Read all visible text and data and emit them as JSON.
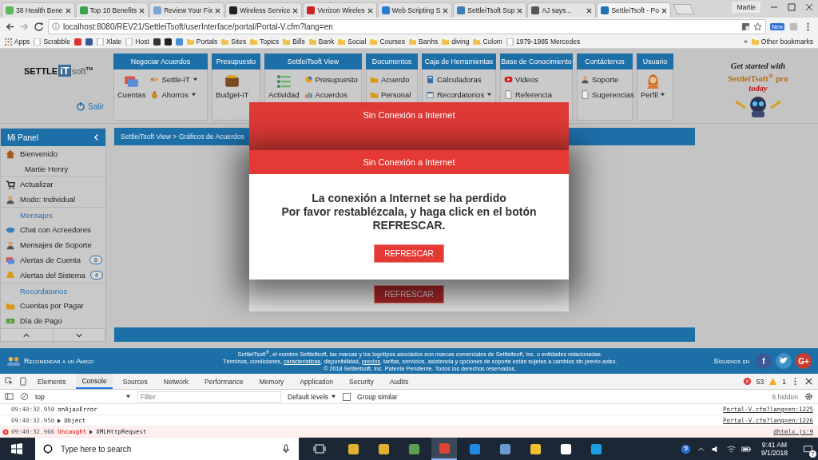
{
  "browser": {
    "tabs": [
      {
        "title": "38 Health Bene",
        "color": "#5cb85c",
        "selected": false
      },
      {
        "title": "Top 10 Benefits",
        "color": "#3fa34d",
        "selected": false
      },
      {
        "title": "Review Your Fix",
        "color": "#7aa7d6",
        "selected": false
      },
      {
        "title": "Wireless Service",
        "color": "#222222",
        "selected": false
      },
      {
        "title": "Verizon Wireles",
        "color": "#cc2222",
        "selected": false
      },
      {
        "title": "Web Scripting S",
        "color": "#2b7bd6",
        "selected": false
      },
      {
        "title": "SettleiTsoft Sup",
        "color": "#3a7fb8",
        "selected": false
      },
      {
        "title": "AJ says...",
        "color": "#555555",
        "selected": false
      },
      {
        "title": "SettleiTsoft - Po",
        "color": "#1a73b5",
        "selected": true
      }
    ],
    "profile": "Martie",
    "url": "localhost:8080/REV21/SettleiTsoft/userInterface/portal/Portal-V.cfm?lang=en",
    "extension_badge": "New",
    "bookmarks": [
      {
        "kind": "apps",
        "label": "Apps"
      },
      {
        "kind": "page",
        "label": "Scrabble"
      },
      {
        "kind": "icon"
      },
      {
        "kind": "icon"
      },
      {
        "kind": "page",
        "label": "Xlate"
      },
      {
        "kind": "page",
        "label": "Host"
      },
      {
        "kind": "icon"
      },
      {
        "kind": "icon"
      },
      {
        "kind": "icon"
      },
      {
        "kind": "folder",
        "label": "Portals"
      },
      {
        "kind": "folder",
        "label": "Sites"
      },
      {
        "kind": "folder",
        "label": "Topics"
      },
      {
        "kind": "folder",
        "label": "Bills"
      },
      {
        "kind": "folder",
        "label": "Bank"
      },
      {
        "kind": "folder",
        "label": "Social"
      },
      {
        "kind": "folder",
        "label": "Courses"
      },
      {
        "kind": "folder",
        "label": "Banhs"
      },
      {
        "kind": "folder",
        "label": "diving"
      },
      {
        "kind": "folder",
        "label": "Colom"
      },
      {
        "kind": "page",
        "label": "1979-1985 Mercedes"
      }
    ],
    "more": "»",
    "other_bookmarks": "Other bookmarks"
  },
  "app": {
    "logo": {
      "parts": [
        "SETTLE",
        "iT",
        "soft"
      ],
      "mark": "TM"
    },
    "logout": "Salir",
    "nav": [
      {
        "title": "Negociar Acuerdos",
        "items": [
          {
            "kind": "big",
            "label": "Cuentas",
            "dropdown": false
          },
          {
            "kind": "small",
            "label": "Settle-iT",
            "dropdown": true
          },
          {
            "kind": "small",
            "label": "Ahorros",
            "dropdown": true
          }
        ]
      },
      {
        "title": "Presupuesto",
        "items": [
          {
            "kind": "big",
            "label": "Budget-iT",
            "dropdown": false
          }
        ]
      },
      {
        "title": "SettleiTsoft View",
        "items": [
          {
            "kind": "big",
            "label": "Actividad",
            "dropdown": false
          },
          {
            "kind": "small",
            "label": "Presupuesto",
            "dropdown": false
          },
          {
            "kind": "small",
            "label": "Acuerdos",
            "dropdown": false
          }
        ]
      },
      {
        "title": "Documentos",
        "items": [
          {
            "kind": "small",
            "label": "Acuerdo",
            "dropdown": false
          },
          {
            "kind": "small",
            "label": "Personal",
            "dropdown": false
          }
        ]
      },
      {
        "title": "Caja de Herramientas",
        "items": [
          {
            "kind": "small",
            "label": "Calculadoras",
            "dropdown": false
          },
          {
            "kind": "small",
            "label": "Recordatorios",
            "dropdown": true
          }
        ]
      },
      {
        "title": "Base de Conocimiento",
        "items": [
          {
            "kind": "small",
            "label": "Videos",
            "dropdown": false
          },
          {
            "kind": "small",
            "label": "Referencia",
            "dropdown": false
          }
        ]
      },
      {
        "title": "Contáctenos",
        "items": [
          {
            "kind": "small",
            "label": "Soporte",
            "dropdown": false
          },
          {
            "kind": "small",
            "label": "Sugerencias",
            "dropdown": false
          }
        ]
      },
      {
        "title": "Usuario",
        "items": [
          {
            "kind": "big",
            "label": "Perfil",
            "dropdown": true
          }
        ]
      }
    ],
    "promo": {
      "line1": "Get started with",
      "line2": "SettleiTsoft$^{®}$ pro",
      "line3": "today"
    },
    "sidebar": {
      "title": "Mi Panel",
      "items": [
        {
          "kind": "item",
          "label": "Bienvenido"
        },
        {
          "kind": "sub",
          "label": "Martie Henry"
        },
        {
          "kind": "item",
          "label": "Actualizar"
        },
        {
          "kind": "item",
          "label": "Modo: Individual"
        },
        {
          "kind": "section",
          "label": "Mensajes"
        },
        {
          "kind": "item",
          "label": "Chat con Acreedores"
        },
        {
          "kind": "item",
          "label": "Mensajes de Soporte"
        },
        {
          "kind": "item",
          "label": "Alertas de Cuenta",
          "badge": "8"
        },
        {
          "kind": "item",
          "label": "Alertas del Sistema",
          "badge": "4"
        },
        {
          "kind": "section",
          "label": "Recordatorios"
        },
        {
          "kind": "item",
          "label": "Cuentas por Pagar"
        },
        {
          "kind": "item",
          "label": "Día de Pago"
        }
      ]
    },
    "breadcrumb": "SettleiTsoft View > Gráficos de Acuerdos",
    "footer": {
      "recommend": "Recomendar a un Amigo",
      "legal_line1": "SettleiTsoft$^{®}$, el nombre Settleitsoft, las marcas y los logotipos asociados son marcas comerciales de Settleitsoft, Inc. o entidades relacionadas.",
      "legal_line2": [
        {
          "kind": "text",
          "text": "Términos, condiciones, "
        },
        {
          "kind": "link",
          "text": "características"
        },
        {
          "kind": "text",
          "text": ", disponibilidad, "
        },
        {
          "kind": "link",
          "text": "precios"
        },
        {
          "kind": "text",
          "text": ", tarifas, servicios, asistencia y opciones de soporte están sujetas a cambios sin previo aviso."
        }
      ],
      "legal_line3": "© 2018 Settleitsoft, Inc. Patente Pendiente. Todos los derechos reservados.",
      "follow": "Síguenos en",
      "social": [
        {
          "kind": "text",
          "glyph": "f",
          "color": "#3b5998"
        },
        {
          "kind": "bird",
          "color": "#3d8fc6"
        },
        {
          "kind": "text",
          "glyph": "G+",
          "color": "#d0382b"
        }
      ]
    }
  },
  "dialog": {
    "titles": [
      "Sin Conexión a Internet",
      "Sin Conexión a Internet"
    ],
    "message": [
      "La conexión a Internet se ha perdido",
      "Por favor restablézcala, y haga click en el botón",
      "REFRESCAR."
    ],
    "buttons": [
      "REFRESCAR",
      "REFRESCAR"
    ]
  },
  "devtools": {
    "tabs": [
      {
        "label": "Elements",
        "selected": false
      },
      {
        "label": "Console",
        "selected": true
      },
      {
        "label": "Sources",
        "selected": false
      },
      {
        "label": "Network",
        "selected": false
      },
      {
        "label": "Performance",
        "selected": false
      },
      {
        "label": "Memory",
        "selected": false
      },
      {
        "label": "Application",
        "selected": false
      },
      {
        "label": "Security",
        "selected": false
      },
      {
        "label": "Audits",
        "selected": false
      }
    ],
    "errors": "53",
    "warnings": "1",
    "context": "top",
    "filter_placeholder": "Filter",
    "levels": "Default levels",
    "group_similar": {
      "label": "Group similar",
      "checked": false
    },
    "hidden": "6 hidden",
    "log": [
      {
        "kind": "log",
        "time": "09:40:32.950",
        "text": "onAjaxError",
        "source": "Portal-V.cfm?lang=en:1225"
      },
      {
        "kind": "object",
        "time": "09:40:32.950",
        "text": "Object",
        "source": "Portal-V.cfm?lang=en:1226"
      },
      {
        "kind": "error",
        "time": "09:40:32.966",
        "prefix": "Uncaught",
        "text": "XMLHttpRequest",
        "source": "dhtmlx.js:9"
      }
    ]
  },
  "taskbar": {
    "search_placeholder": "Type here to search",
    "apps": [
      {
        "selected": false
      },
      {
        "selected": false
      },
      {
        "selected": false
      },
      {
        "selected": true
      },
      {
        "selected": false
      },
      {
        "selected": false
      },
      {
        "selected": false
      },
      {
        "selected": false
      },
      {
        "selected": false
      }
    ],
    "time": "9:41 AM",
    "date": "9/1/2018",
    "notifications": "7"
  }
}
